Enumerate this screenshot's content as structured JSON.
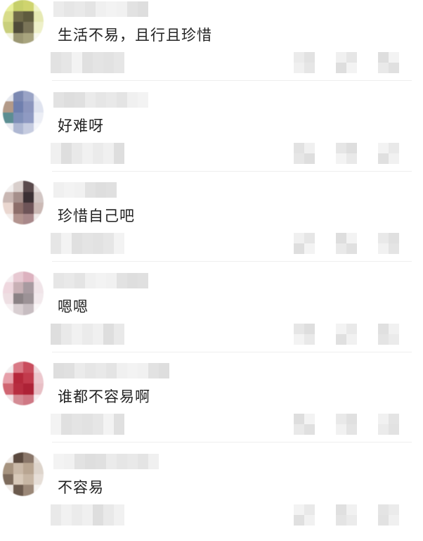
{
  "comments": [
    {
      "text": "生活不易，且行且珍惜"
    },
    {
      "text": "好难呀"
    },
    {
      "text": "珍惜自己吧"
    },
    {
      "text": "嗯嗯"
    },
    {
      "text": "谁都不容易啊"
    },
    {
      "text": "不容易"
    }
  ],
  "colors": {
    "text": "#222222",
    "divider": "#eeeeee",
    "background": "#ffffff"
  },
  "avatars": [
    [
      "#e8ef9a",
      "#c6cf6a",
      "#cfd46e",
      "#f1f4c8",
      "#d8dc8a",
      "#6f6a49",
      "#5f5b3e",
      "#e6e9b3",
      "#c9cf7c",
      "#4f4b39",
      "#7a7458",
      "#eef0c9",
      "#f2f3dd",
      "#9b9773",
      "#a8a47e",
      "#f7f7ec"
    ],
    [
      "#e6e8ee",
      "#7c89b2",
      "#9aa4c6",
      "#e8ebf3",
      "#b39a88",
      "#6f7fae",
      "#8b95bd",
      "#dfe3ef",
      "#5c8e92",
      "#7f8fb8",
      "#8f9ac2",
      "#eceef5",
      "#e9ebf1",
      "#aeb7d2",
      "#c6cce0",
      "#f5f6fa"
    ],
    [
      "#f3f0ef",
      "#d9cfcc",
      "#5a4a4c",
      "#e4dcdb",
      "#c9b7b3",
      "#a58f8b",
      "#3b3034",
      "#d2c6c4",
      "#ead7d0",
      "#8d6e6a",
      "#6e5458",
      "#cbb9b5",
      "#f4eeec",
      "#b3948f",
      "#a8888a",
      "#efe9e8"
    ],
    [
      "#f6eef1",
      "#e7c9d2",
      "#dcb2bf",
      "#f5e7ec",
      "#efd8df",
      "#c8b0b5",
      "#a89aa0",
      "#f0e4e8",
      "#eedfe3",
      "#8b8285",
      "#9c9296",
      "#f2e9ec",
      "#f7f1f3",
      "#d9cfd2",
      "#c7bdc1",
      "#faf6f7"
    ],
    [
      "#f3eff0",
      "#d97a86",
      "#c94d5d",
      "#f0d8dc",
      "#e6a0aa",
      "#b5283b",
      "#c23a4c",
      "#ecc7cd",
      "#d06571",
      "#b72d40",
      "#ad2236",
      "#e8bfc5",
      "#f2e1e4",
      "#d48b94",
      "#cf7884",
      "#f7eef0"
    ],
    [
      "#efeae6",
      "#5b4a3f",
      "#8a776a",
      "#e3dbd4",
      "#a6937f",
      "#c9b8a7",
      "#b8a591",
      "#ddd4cb",
      "#7d6b5c",
      "#d8c9b9",
      "#c7b6a4",
      "#e6ded7",
      "#f1ece8",
      "#6b5a4d",
      "#9b8878",
      "#f5f2ef"
    ]
  ]
}
